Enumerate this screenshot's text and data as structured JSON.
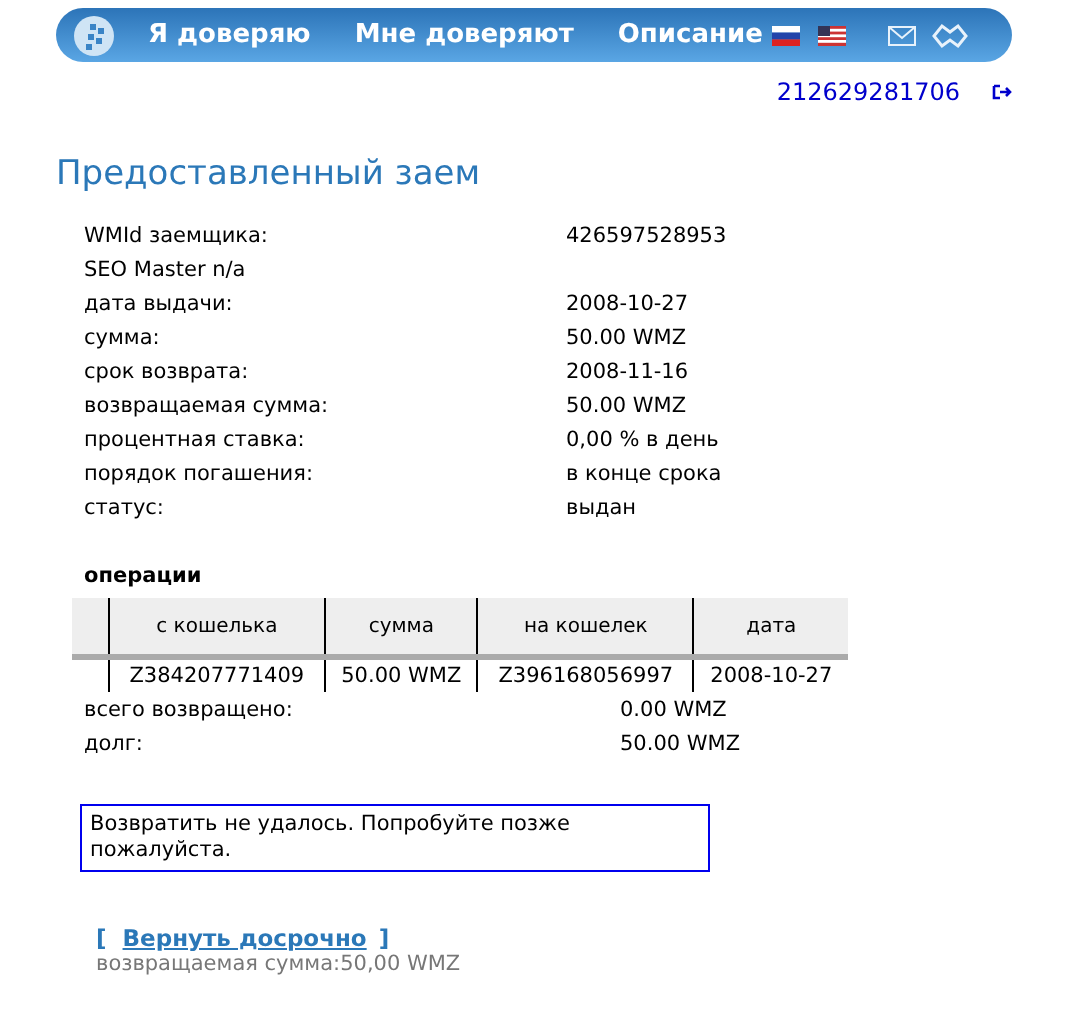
{
  "nav": {
    "items": [
      "Я доверяю",
      "Мне доверяют",
      "Описание"
    ]
  },
  "account": {
    "wmid": "212629281706"
  },
  "title": "Предоставленный заем",
  "details": [
    {
      "label": "WMId заемщика:",
      "value": "426597528953"
    },
    {
      "label": "SEO Master n/a"
    },
    {
      "label": "дата выдачи:",
      "value": "2008-10-27"
    },
    {
      "label": "сумма:",
      "value": "50.00 WMZ"
    },
    {
      "label": "срок возврата:",
      "value": "2008-11-16"
    },
    {
      "label": "возвращаемая сумма:",
      "value": "50.00 WMZ"
    },
    {
      "label": "процентная ставка:",
      "value": "0,00 % в день"
    },
    {
      "label": "порядок погашения:",
      "value": "в конце срока"
    },
    {
      "label": "статус:",
      "value": "выдан"
    }
  ],
  "operations": {
    "heading": "операции",
    "columns": [
      "с кошелька",
      "сумма",
      "на кошелек",
      "дата"
    ],
    "rows": [
      [
        "Z384207771409",
        "50.00 WMZ",
        "Z396168056997",
        "2008-10-27"
      ]
    ]
  },
  "totals": [
    {
      "label": "всего возвращено:",
      "value": "0.00 WMZ"
    },
    {
      "label": "долг:",
      "value": "50.00 WMZ"
    }
  ],
  "error": "Возвратить не удалось. Попробуйте позже пожалуйста.",
  "repay": {
    "open": "[",
    "link": "Вернуть досрочно",
    "close": "]",
    "note": "возвращаемая сумма:50,00 WMZ"
  }
}
